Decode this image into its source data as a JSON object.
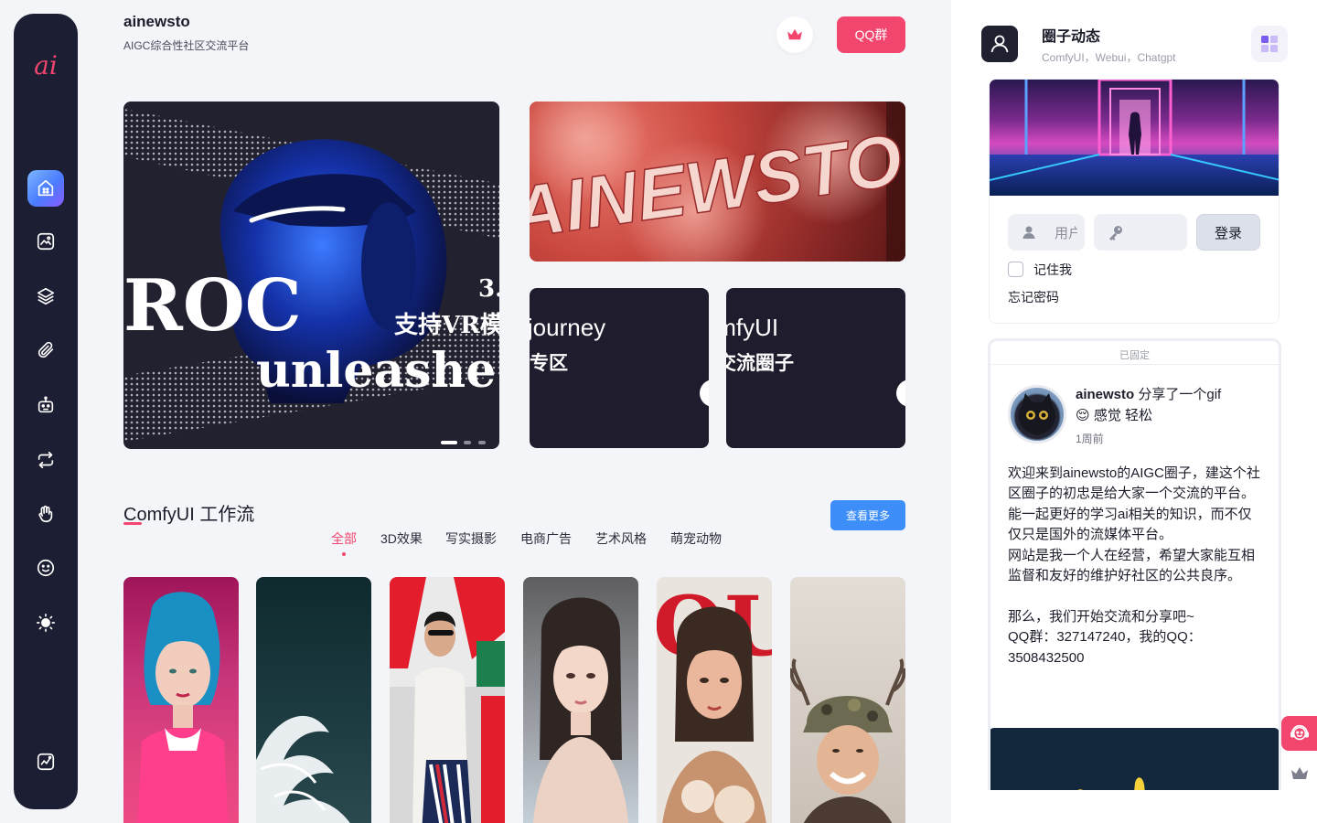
{
  "sidebar": {
    "logo": "ai",
    "items": [
      {
        "name": "home",
        "icon": "home-icon"
      },
      {
        "name": "gallery",
        "icon": "image-icon"
      },
      {
        "name": "layers",
        "icon": "layers-icon"
      },
      {
        "name": "attachments",
        "icon": "paperclip-icon"
      },
      {
        "name": "robot",
        "icon": "robot-icon"
      },
      {
        "name": "repeat",
        "icon": "repeat-icon"
      },
      {
        "name": "hand",
        "icon": "hand-icon"
      },
      {
        "name": "emoji",
        "icon": "smiley-icon"
      },
      {
        "name": "theme",
        "icon": "sun-icon"
      },
      {
        "name": "stats",
        "icon": "chart-icon"
      }
    ]
  },
  "header": {
    "title": "ainewsto",
    "subtitle": "AIGC综合性社区交流平台",
    "qq_button": "QQ群"
  },
  "banners": {
    "main_heading": "3.",
    "main_line1": "支持VR模",
    "main_line2": "unleashe",
    "main_big": "ROC",
    "red_text": "AINEWSTO",
    "small": [
      {
        "en": "Midjourney",
        "cn": "专区"
      },
      {
        "en": "ComfyUI",
        "cn": "交流圈子"
      }
    ]
  },
  "section": {
    "title": "ComfyUI 工作流",
    "more_button": "查看更多",
    "tabs": [
      "全部",
      "3D效果",
      "写实摄影",
      "电商广告",
      "艺术风格",
      "萌宠动物"
    ],
    "active_tab": "全部"
  },
  "right_panel": {
    "title": "圈子动态",
    "subtitle": "ComfyUI，Webui，Chatgpt",
    "login": {
      "username_placeholder": "用户名",
      "password_placeholder": "",
      "login_button": "登录",
      "remember_label": "记住我",
      "forgot_label": "忘记密码"
    },
    "post": {
      "pinned_label": "已固定",
      "author": "ainewsto",
      "action": " 分享了一个gif",
      "mood_emoji": "😌",
      "mood": "感觉 轻松",
      "time": "1周前",
      "body": "欢迎来到ainewsto的AIGC圈子，建这个社区圈子的初忠是给大家一个交流的平台。\n能一起更好的学习ai相关的知识，而不仅仅只是国外的流媒体平台。\n网站是我一个人在经营，希望大家能互相监督和友好的维护好社区的公共良序。\n\n那么，我们开始交流和分享吧~\nQQ群：327147240，我的QQ：3508432500"
    }
  },
  "colors": {
    "accent_pink": "#f2466e",
    "sidebar_bg": "#1c1e33",
    "more_blue": "#3d8ef8"
  }
}
